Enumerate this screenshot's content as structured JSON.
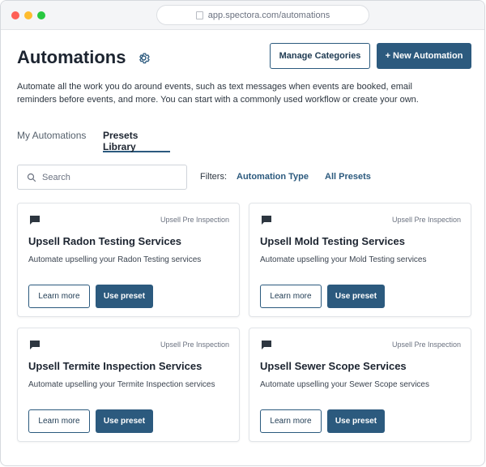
{
  "browser": {
    "url": "app.spectora.com/automations"
  },
  "header": {
    "title": "Automations",
    "manage_categories_label": "Manage Categories",
    "new_automation_label": "+ New Automation",
    "description": "Automate all the work you do around events, such as text messages when events are booked, email reminders before events, and more. You can start with a commonly used workflow or create your own."
  },
  "tabs": [
    {
      "label": "My Automations",
      "active": false
    },
    {
      "label": "Presets Library",
      "active": true
    }
  ],
  "search": {
    "placeholder": "Search",
    "value": ""
  },
  "filters": {
    "label": "Filters:",
    "automation_type": "Automation Type",
    "all_presets": "All Presets"
  },
  "cards": [
    {
      "category": "Upsell Pre Inspection",
      "title": "Upsell Radon Testing Services",
      "description": "Automate upselling your Radon Testing services",
      "learn_label": "Learn more",
      "use_label": "Use preset"
    },
    {
      "category": "Upsell Pre Inspection",
      "title": "Upsell Mold Testing Services",
      "description": "Automate upselling your Mold Testing services",
      "learn_label": "Learn more",
      "use_label": "Use preset"
    },
    {
      "category": "Upsell Pre Inspection",
      "title": "Upsell Termite Inspection Services",
      "description": "Automate upselling your Termite Inspection services",
      "learn_label": "Learn more",
      "use_label": "Use preset"
    },
    {
      "category": "Upsell Pre Inspection",
      "title": "Upsell Sewer Scope Services",
      "description": "Automate upselling your Sewer Scope services",
      "learn_label": "Learn more",
      "use_label": "Use preset"
    }
  ],
  "icons": {
    "settings": "gear-icon",
    "search": "search-icon",
    "card": "chat-bubble-icon",
    "url": "lock-icon"
  },
  "colors": {
    "primary": "#2c5a7e",
    "title": "#1c2430"
  }
}
